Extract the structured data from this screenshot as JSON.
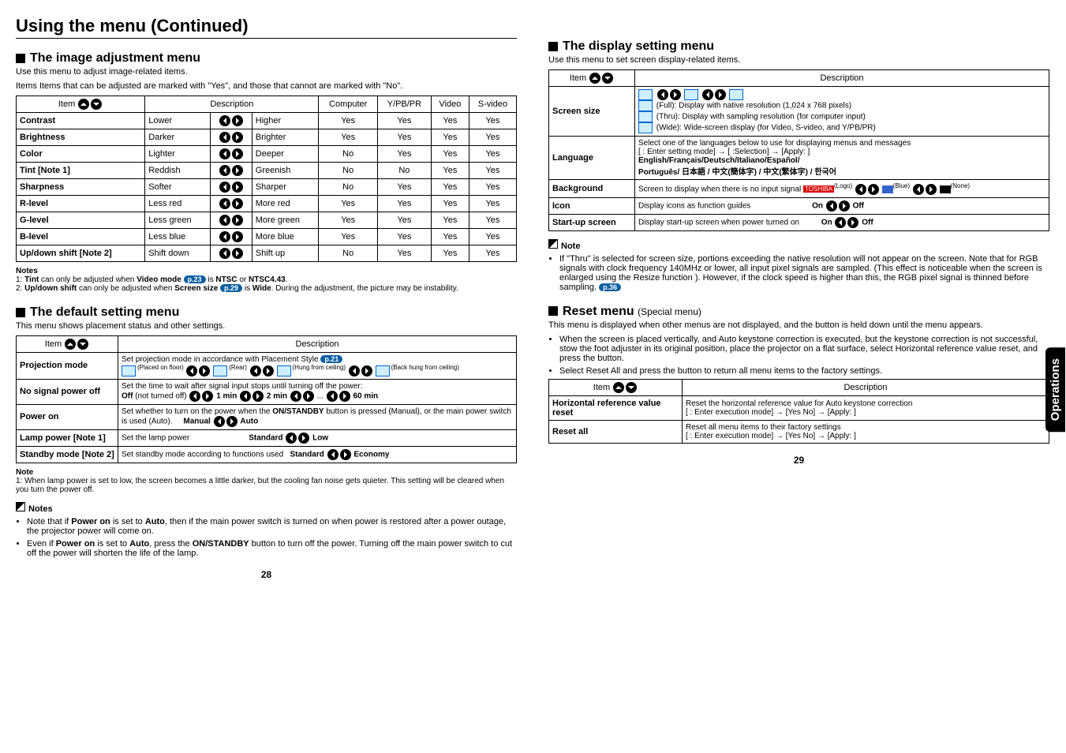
{
  "title": "Using the menu (Continued)",
  "left": {
    "imgAdj": {
      "heading": "The image adjustment menu",
      "sub1": "Use this menu to adjust image-related items.",
      "sub2": "Items Items that can be adjusted are marked with  \"Yes\", and those that cannot are marked with \"No\".",
      "hdr": {
        "item": "Item",
        "desc": "Description",
        "computer": "Computer",
        "ypbpr": "Y/PB/PR",
        "video": "Video",
        "svideo": "S-video"
      },
      "rows": [
        {
          "name": "Contrast",
          "low": "Lower",
          "high": "Higher",
          "c": "Yes",
          "y": "Yes",
          "v": "Yes",
          "s": "Yes"
        },
        {
          "name": "Brightness",
          "low": "Darker",
          "high": "Brighter",
          "c": "Yes",
          "y": "Yes",
          "v": "Yes",
          "s": "Yes"
        },
        {
          "name": "Color",
          "low": "Lighter",
          "high": "Deeper",
          "c": "No",
          "y": "Yes",
          "v": "Yes",
          "s": "Yes"
        },
        {
          "name": "Tint [Note 1]",
          "low": "Reddish",
          "high": "Greenish",
          "c": "No",
          "y": "No",
          "v": "Yes",
          "s": "Yes"
        },
        {
          "name": "Sharpness",
          "low": "Softer",
          "high": "Sharper",
          "c": "No",
          "y": "Yes",
          "v": "Yes",
          "s": "Yes"
        },
        {
          "name": "R-level",
          "low": "Less red",
          "high": "More red",
          "c": "Yes",
          "y": "Yes",
          "v": "Yes",
          "s": "Yes"
        },
        {
          "name": "G-level",
          "low": "Less green",
          "high": "More green",
          "c": "Yes",
          "y": "Yes",
          "v": "Yes",
          "s": "Yes"
        },
        {
          "name": "B-level",
          "low": "Less blue",
          "high": "More blue",
          "c": "Yes",
          "y": "Yes",
          "v": "Yes",
          "s": "Yes"
        },
        {
          "name": "Up/down shift [Note 2]",
          "low": "Shift down",
          "high": "Shift up",
          "c": "No",
          "y": "Yes",
          "v": "Yes",
          "s": "Yes"
        }
      ],
      "notesLabel": "Notes",
      "note1a": "1: ",
      "note1b": "Tint",
      "note1c": " can only be adjusted when ",
      "note1d": "Video mode",
      "note1e": " is ",
      "note1f": "NTSC",
      "note1g": " or ",
      "note1h": "NTSC4.43",
      "note1i": ".",
      "note1pill": "p.23",
      "note2a": "2: ",
      "note2b": "Up/down shift",
      "note2c": " can only be adjusted when ",
      "note2d": "Screen size",
      "note2e": " is ",
      "note2f": "Wide",
      "note2g": ".  During the adjustment, the picture may be instability.",
      "note2pill": "p.29"
    },
    "default": {
      "heading": "The default setting menu",
      "sub": "This menu shows placement status and other settings.",
      "hdr": {
        "item": "Item",
        "desc": "Description"
      },
      "rows": [
        {
          "name": "Projection mode",
          "descA": "Set projection mode in accordance with Placement Style ",
          "pill": "p.21",
          "placed": "(Placed on floor)",
          "rear": "(Rear)",
          "hung": "(Hung from ceiling)",
          "back": "(Back hung from ceiling)"
        },
        {
          "name": "No signal power off",
          "descA": "Set the time to wait after signal input stops until turning off the power:",
          "opts": "Off (not turned off)    1 min    2 min    ...   60 min"
        },
        {
          "name": "Power on",
          "descA": "Set whether to turn on the power when the ",
          "descB": "ON/STANDBY",
          "descC": " button is pressed (Manual), or the main power switch is used (Auto).",
          "manual": "Manual",
          "auto": "Auto"
        },
        {
          "name": "Lamp power [Note 1]",
          "descA": "Set the lamp power",
          "standard": "Standard",
          "low": "Low"
        },
        {
          "name": "Standby mode [Note 2]",
          "descA": "Set standby mode according to functions used",
          "standard": "Standard",
          "economy": "Economy"
        }
      ],
      "noteLabel": "Note",
      "note1": "1: When lamp power is set to low, the screen becomes a little darker, but the cooling fan noise gets quieter. This setting will be cleared when you turn the power off.",
      "notesHdr": "Notes",
      "bul1a": "Note that if ",
      "bul1b": "Power on",
      "bul1c": " is set to ",
      "bul1d": "Auto",
      "bul1e": ", then if the main power switch is turned on when power is restored after a power outage, the projector power will come on.",
      "bul2a": "Even if ",
      "bul2b": "Power on",
      "bul2c": " is set to ",
      "bul2d": "Auto",
      "bul2e": ", press the ",
      "bul2f": "ON/STANDBY",
      "bul2g": " button to turn off the power. Turning off the main power switch to cut off the power will shorten the life of the lamp."
    },
    "pgnum": "28"
  },
  "right": {
    "display": {
      "heading": "The display setting menu",
      "sub": "Use this menu to set screen display-related items.",
      "hdr": {
        "item": "Item",
        "desc": "Description"
      },
      "screensize": {
        "name": "Screen size",
        "full": "(Full):  Display with native resolution (1,024 x 768 pixels)",
        "thru": "(Thru): Display with sampling resolution (for computer input)",
        "wide": "(Wide):  Wide-screen display (for Video, S-video, and Y/PB/PR)"
      },
      "language": {
        "name": "Language",
        "l1": "Select one of the languages below to use for displaying menus and messages",
        "l2": "[    : Enter setting mode] → [        :Selection] → [Apply:    ]",
        "l3": "English/Français/Deutsch/Italiano/Español/",
        "l4": "Português/ 日本語 / 中文(簡体字) / 中文(繁体字) / 한국어"
      },
      "background": {
        "name": "Background",
        "desc": "Screen to display when there is no input signal",
        "logo": "(Logo)",
        "blue": "(Blue)",
        "none": "(None)",
        "toshiba": "TOSHIBA"
      },
      "icon": {
        "name": "Icon",
        "desc": "Display icons as function guides",
        "on": "On",
        "off": "Off"
      },
      "startup": {
        "name": "Start-up screen",
        "desc": "Display start-up screen when power turned on",
        "on": "On",
        "off": "Off"
      },
      "noteHdr": "Note",
      "noteText": "If \"Thru\" is selected for screen size, portions exceeding the native resolution will not appear on the screen. Note that for RGB signals with clock frequency 140MHz or lower, all input pixel signals are sampled. (This effect is noticeable when the screen is enlarged using the Resize function        ). However, if the clock speed is higher than this, the RGB pixel signal is thinned before sampling.",
      "notePill": "p.36"
    },
    "reset": {
      "heading": "Reset menu",
      "special": "(Special menu)",
      "sub": "This menu is displayed when other menus are not displayed, and the     button is held down until the menu appears.",
      "bul1": "When the screen is placed vertically, and Auto keystone correction is executed, but the keystone correction is not successful, stow the foot adjuster in its original position, place the projector on a flat surface, select Horizontal reference value reset, and press the     button.",
      "bul2": "Select Reset All and press the     button to return all menu items to the factory settings.",
      "hdr": {
        "item": "Item",
        "desc": "Description"
      },
      "rows": [
        {
          "name": "Horizontal reference value reset",
          "desc": "Reset the horizontal reference value for Auto keystone correction",
          "flow": "[    : Enter execution mode] → [Yes        No] → [Apply:    ]"
        },
        {
          "name": "Reset all",
          "desc": "Reset all menu items to their factory settings",
          "flow": "[    : Enter execution mode] → [Yes        No] → [Apply:    ]"
        }
      ]
    },
    "pgnum": "29",
    "tab": "Operations"
  }
}
